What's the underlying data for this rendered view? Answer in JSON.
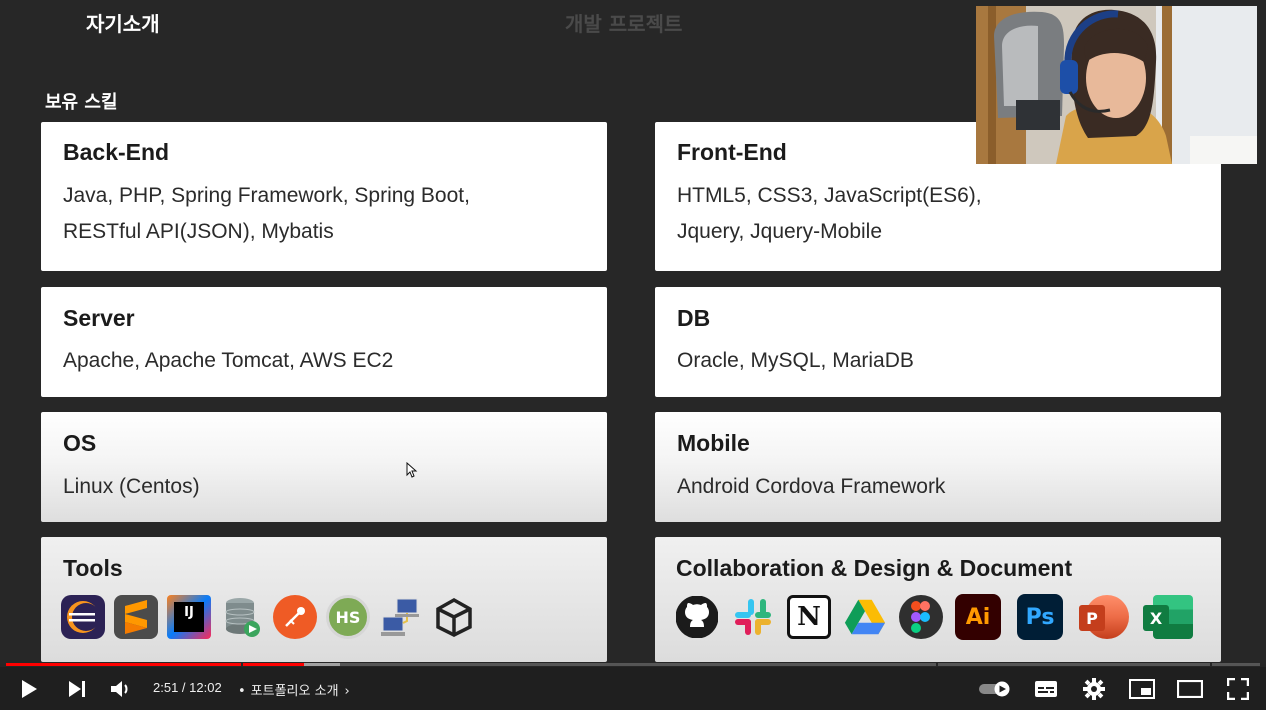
{
  "slide": {
    "tabs": [
      "자기소개",
      "개발 프로젝트"
    ],
    "section_title": "보유 스킬",
    "cards": [
      {
        "title": "Back-End",
        "lines": [
          "Java, PHP, Spring Framework, Spring Boot,",
          "RESTful API(JSON), Mybatis"
        ]
      },
      {
        "title": "Front-End",
        "lines": [
          "HTML5, CSS3, JavaScript(ES6),",
          "Jquery, Jquery-Mobile"
        ]
      },
      {
        "title": "Server",
        "lines": [
          "Apache, Apache Tomcat, AWS EC2"
        ]
      },
      {
        "title": "DB",
        "lines": [
          "Oracle, MySQL, MariaDB"
        ]
      },
      {
        "title": "OS",
        "lines": [
          "Linux (Centos)"
        ]
      },
      {
        "title": "Mobile",
        "lines": [
          "Android Cordova Framework"
        ]
      },
      {
        "title": "Tools"
      },
      {
        "title": "Collaboration & Design & Document"
      }
    ],
    "tool_icons": [
      "eclipse-icon",
      "sublime-text-icon",
      "intellij-idea-icon",
      "database-tool-icon",
      "postman-icon",
      "heidisql-icon",
      "network-ftp-icon",
      "unity-icon"
    ],
    "tool_glyphs": {
      "intellij": "IJ",
      "heidisql": "HS"
    },
    "collab_icons": [
      "github-icon",
      "slack-icon",
      "notion-icon",
      "google-drive-icon",
      "figma-icon",
      "illustrator-icon",
      "photoshop-icon",
      "powerpoint-icon",
      "excel-icon"
    ],
    "collab_glyphs": {
      "notion": "N",
      "illustrator": "Ai",
      "photoshop": "Ps",
      "powerpoint": "P",
      "excel": "X"
    }
  },
  "player": {
    "time": "2:51 / 12:02",
    "separator": "•",
    "chapter": "포트폴리오 소개",
    "progress_played_fraction": 0.238,
    "progress_buffered_fraction": 0.266,
    "accent": "#ff0000"
  }
}
